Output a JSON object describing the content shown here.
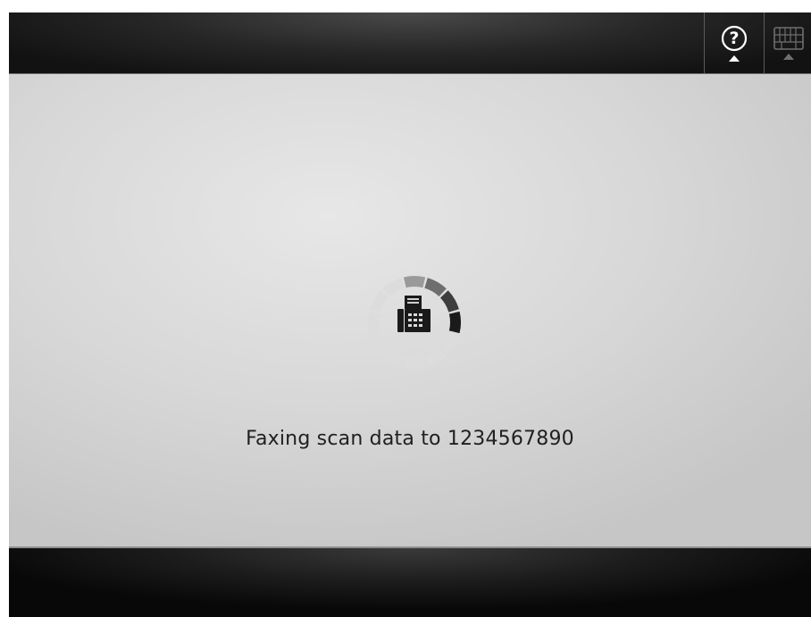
{
  "header": {
    "help_button": {
      "icon": "help-icon",
      "label": "?"
    },
    "keyboard_button": {
      "icon": "keyboard-icon"
    }
  },
  "main": {
    "progress": {
      "icon": "fax-icon",
      "filled_segments": 4,
      "total_segments": 12
    },
    "status_text": "Faxing scan data to 1234567890"
  },
  "colors": {
    "header_bg": "#1e1e1e",
    "content_bg": "#d8d8d8",
    "text": "#202020",
    "spinner_active": "#1e1e1e",
    "spinner_inactive": "#dcdcdc"
  }
}
